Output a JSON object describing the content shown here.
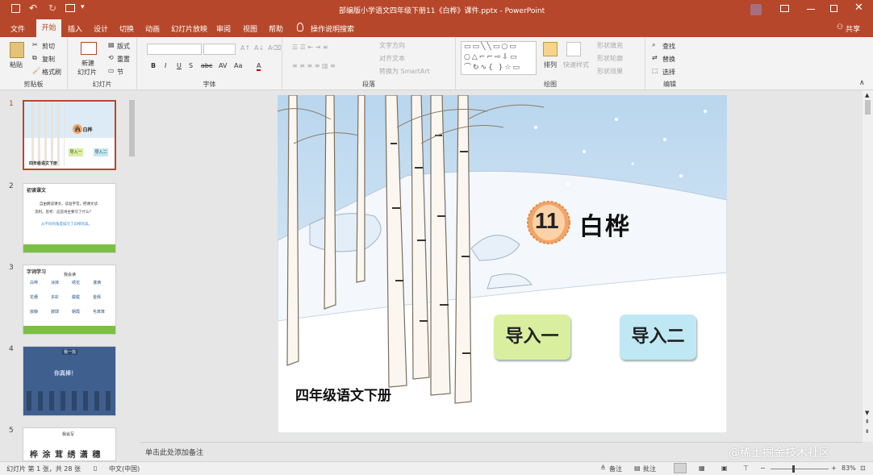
{
  "window": {
    "title": "部编版小学语文四年级下册11《白桦》课件.pptx  -  PowerPoint",
    "share": "共享",
    "help_search": "操作说明搜索"
  },
  "tabs": [
    "文件",
    "开始",
    "插入",
    "设计",
    "切换",
    "动画",
    "幻灯片放映",
    "审阅",
    "视图",
    "帮助"
  ],
  "ribbon": {
    "clipboard": {
      "label": "剪贴板",
      "paste": "粘贴",
      "cut": "剪切",
      "copy": "复制",
      "format_painter": "格式刷"
    },
    "slides": {
      "label": "幻灯片",
      "new_slide_line1": "新建",
      "new_slide_line2": "幻灯片",
      "layout": "版式",
      "reset": "重置",
      "section": "节"
    },
    "font": {
      "label": "字体",
      "bold": "B",
      "italic": "I",
      "underline": "U",
      "strike": "S",
      "shadow": "abc",
      "spacing": "AV",
      "case": "Aa",
      "color": "A"
    },
    "paragraph": {
      "label": "段落",
      "text_direction": "文字方向",
      "align_text": "对齐文本",
      "smartart": "转换为 SmartArt"
    },
    "drawing": {
      "label": "绘图",
      "arrange": "排列",
      "quick_styles": "快速样式",
      "shape_fill": "形状填充",
      "shape_outline": "形状轮廓",
      "shape_effects": "形状效果"
    },
    "editing": {
      "label": "编辑",
      "find": "查找",
      "replace": "替换",
      "select": "选择"
    }
  },
  "thumbnails": [
    {
      "num": "1",
      "title": "11 白桦",
      "btn1": "导入一",
      "btn2": "导入二",
      "foot": "四年级语文下册"
    },
    {
      "num": "2",
      "heading": "初读课文",
      "line1": "自由朗读课文，读准字音，把课文读",
      "line2": "流利。思考：这首诗主要写了什么？",
      "answer": "从不同的角度描写了白桦的美。"
    },
    {
      "num": "3",
      "heading": "字词学习",
      "sub": "我会读",
      "words": [
        "白桦",
        "涂抹",
        "绣花",
        "灌满",
        "花穗",
        "多彩",
        "朦胧",
        "金辉",
        "寂静",
        "披肆",
        "朝霞",
        "毛茸茸"
      ]
    },
    {
      "num": "4",
      "heading": "我一找",
      "banner": "你真棒！"
    },
    {
      "num": "5",
      "heading": "我会写",
      "chars": "桦 涂 茸 绣 潇 穗"
    }
  ],
  "slide": {
    "number": "11",
    "title": "白桦",
    "btn1": "导入一",
    "btn2": "导入二",
    "footer": "四年级语文下册"
  },
  "notes_placeholder": "单击此处添加备注",
  "watermark": "@稀土掘金技术社区",
  "status": {
    "slide_info": "幻灯片 第 1 张，共 28 张",
    "language": "中文(中国)",
    "notes": "备注",
    "comments": "批注",
    "zoom": "83%",
    "zoom_level": 0.83
  },
  "colors": {
    "accent": "#b7472a",
    "sky": "#cfe3f3",
    "btn1": "#d9ef9f",
    "btn2": "#bfe8f4",
    "badge": "#f2a56a"
  }
}
